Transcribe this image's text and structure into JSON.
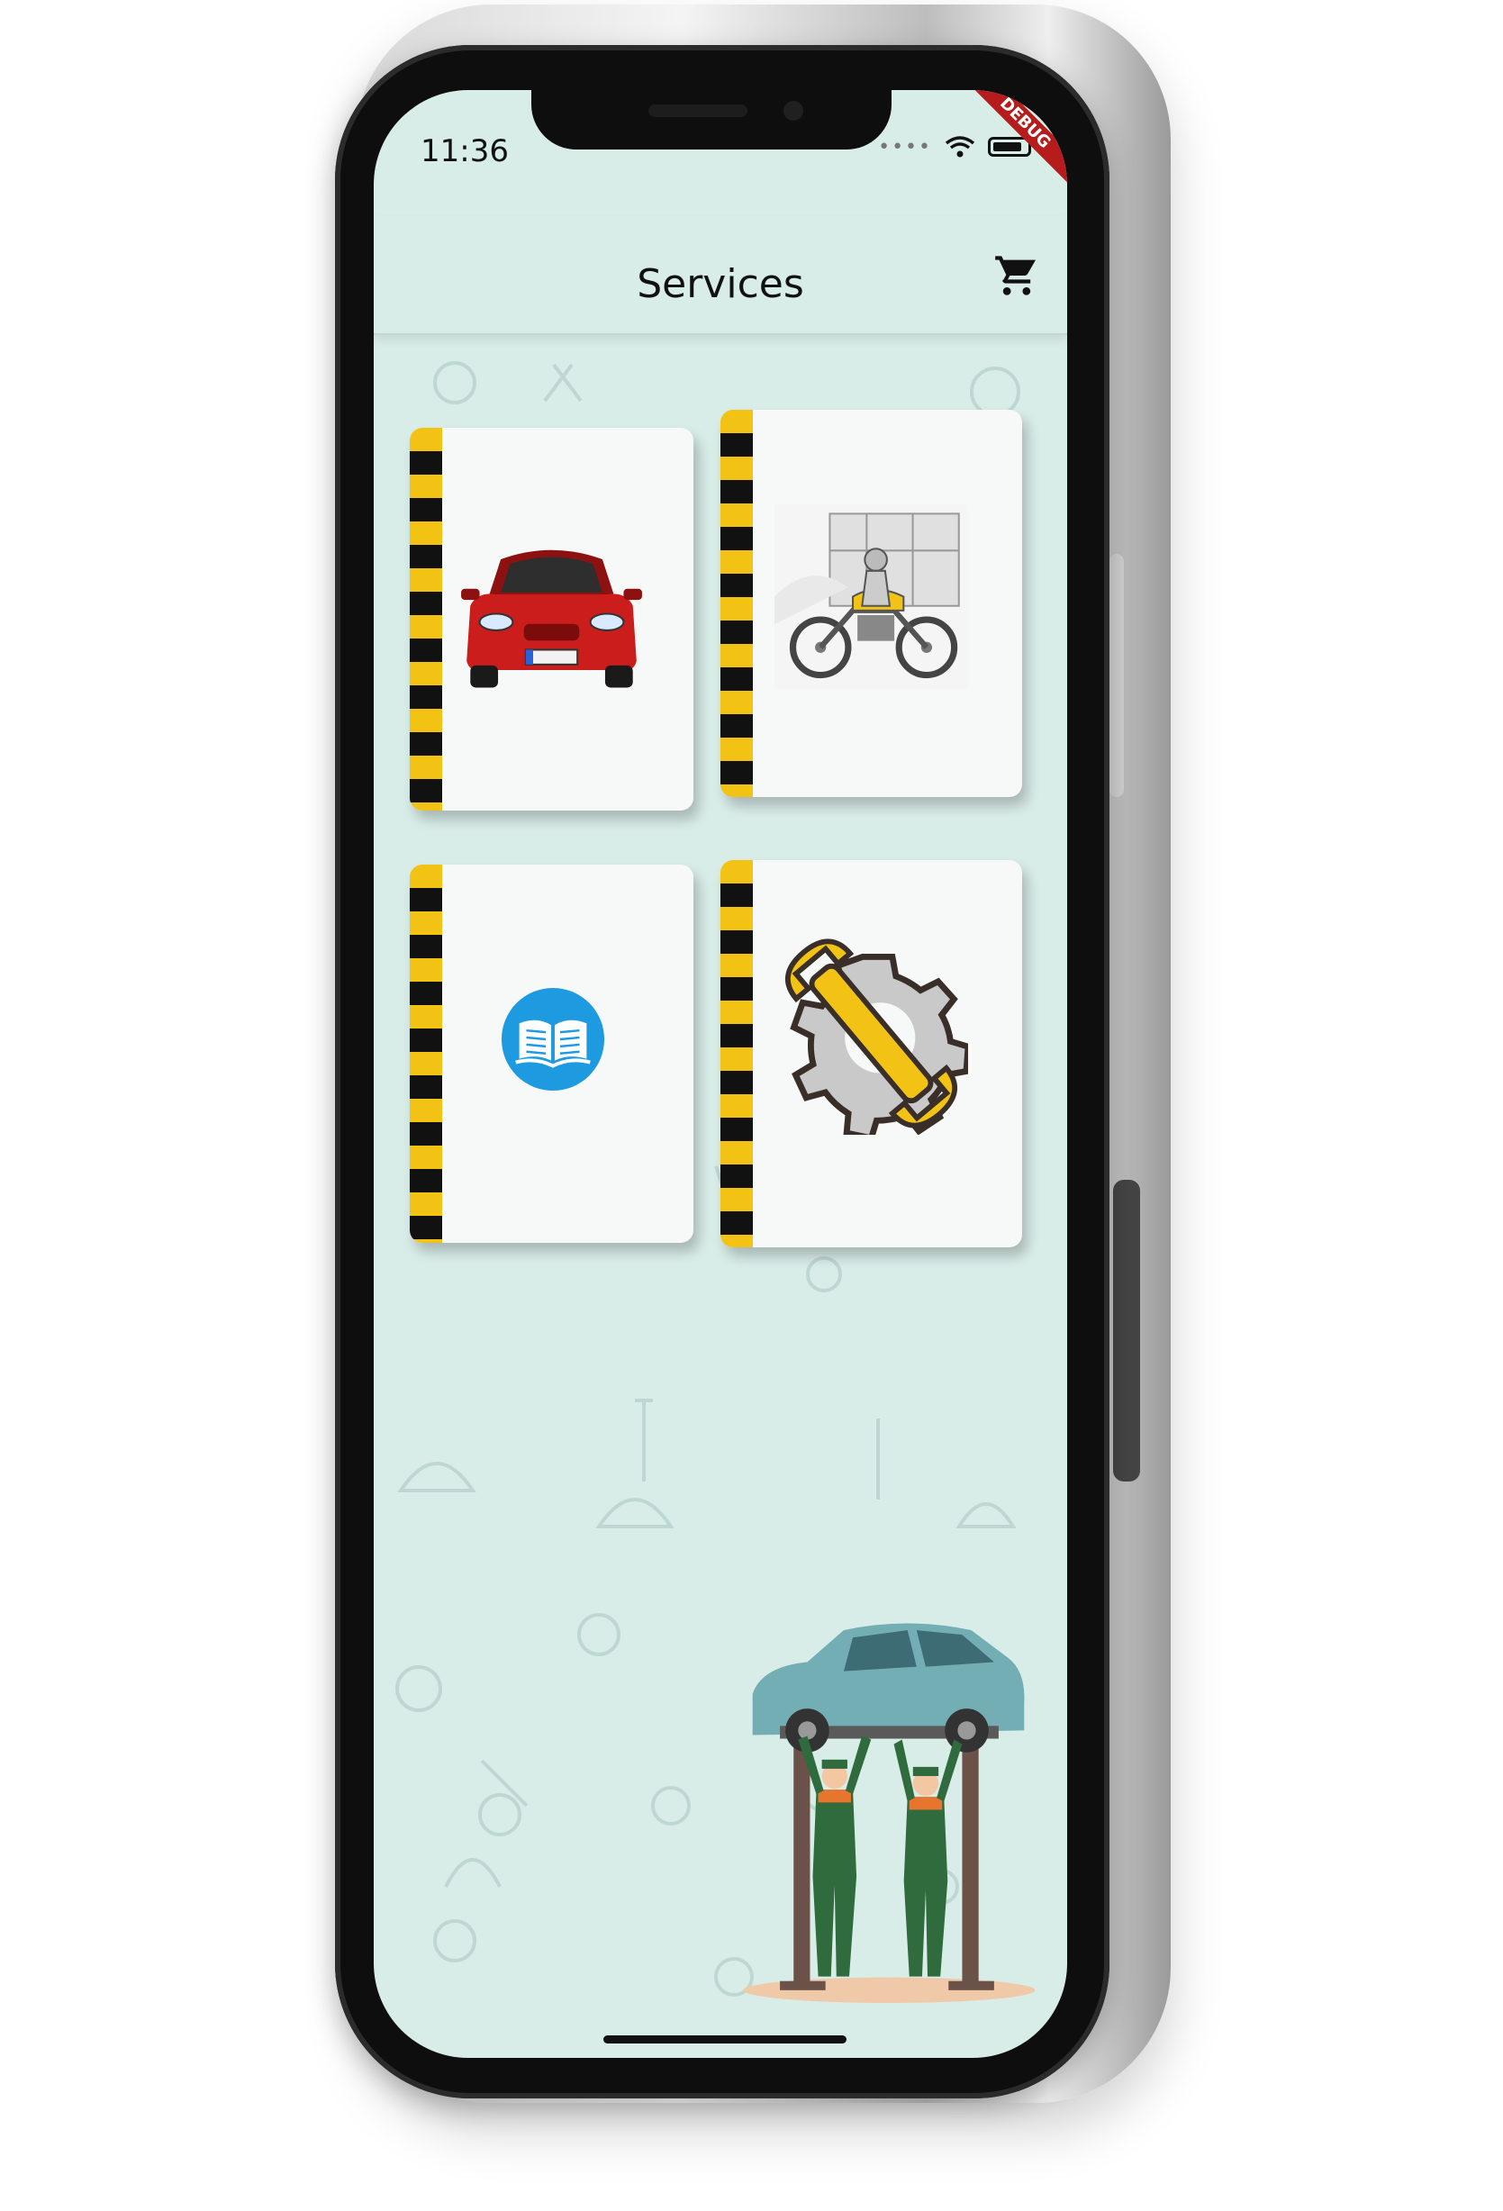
{
  "status_bar": {
    "time": "11:36",
    "debug_banner": "DEBUG"
  },
  "app_bar": {
    "title": "Services",
    "action_icon": "cart-icon"
  },
  "service_cards": [
    {
      "id": "car",
      "icon": "red-car-image"
    },
    {
      "id": "bike",
      "icon": "motorcycle-image"
    },
    {
      "id": "manual",
      "icon": "book-icon"
    },
    {
      "id": "repair",
      "icon": "wrench-gear-icon"
    }
  ],
  "colors": {
    "background": "#d8ece8",
    "stripe_yellow": "#f2c314",
    "stripe_black": "#111111",
    "book_blue": "#1e9ae0",
    "car_red": "#cc1d1d"
  }
}
